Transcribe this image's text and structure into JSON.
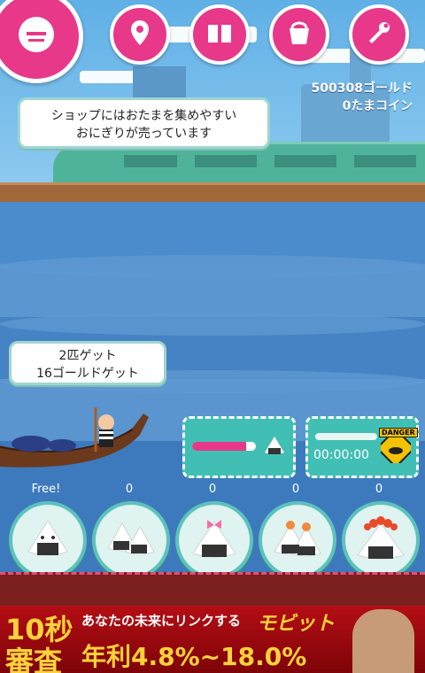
{
  "header": {
    "menu_icon": "menu-face-icon",
    "buttons": [
      {
        "icon": "map-pin-icon"
      },
      {
        "icon": "book-icon"
      },
      {
        "icon": "bucket-icon"
      },
      {
        "icon": "wrench-icon"
      }
    ]
  },
  "status": {
    "gold": "500308ゴールド",
    "coins": "0たまコイン"
  },
  "hint_bubble": {
    "line1": "ショップにはおたまを集めやすい",
    "line2": "おにぎりが売っています"
  },
  "catch_bubble": {
    "line1": "2匹ゲット",
    "line2": "16ゴールドゲット"
  },
  "panels": {
    "bait": {
      "progress": 0.85,
      "icon": "onigiri-icon"
    },
    "timer": {
      "time": "00:00:00",
      "progress": 1.0,
      "icon": "danger-icon",
      "badge": "DANGER"
    }
  },
  "slots": [
    {
      "count": "Free!",
      "icon": "onigiri-plain-icon"
    },
    {
      "count": "0",
      "icon": "onigiri-double-icon"
    },
    {
      "count": "0",
      "icon": "onigiri-ribbon-icon"
    },
    {
      "count": "0",
      "icon": "onigiri-salmon-icon"
    },
    {
      "count": "0",
      "icon": "onigiri-ikura-icon"
    }
  ],
  "ad": {
    "left_top": "10秒",
    "left_bottom": "審査",
    "tagline": "あなたの未来にリンクする",
    "brand": "モビット",
    "rate": "年利4.8%~18.0%"
  },
  "colors": {
    "accent": "#e8388a",
    "panel": "#41bfb5",
    "sea": "#3f7fc2"
  }
}
